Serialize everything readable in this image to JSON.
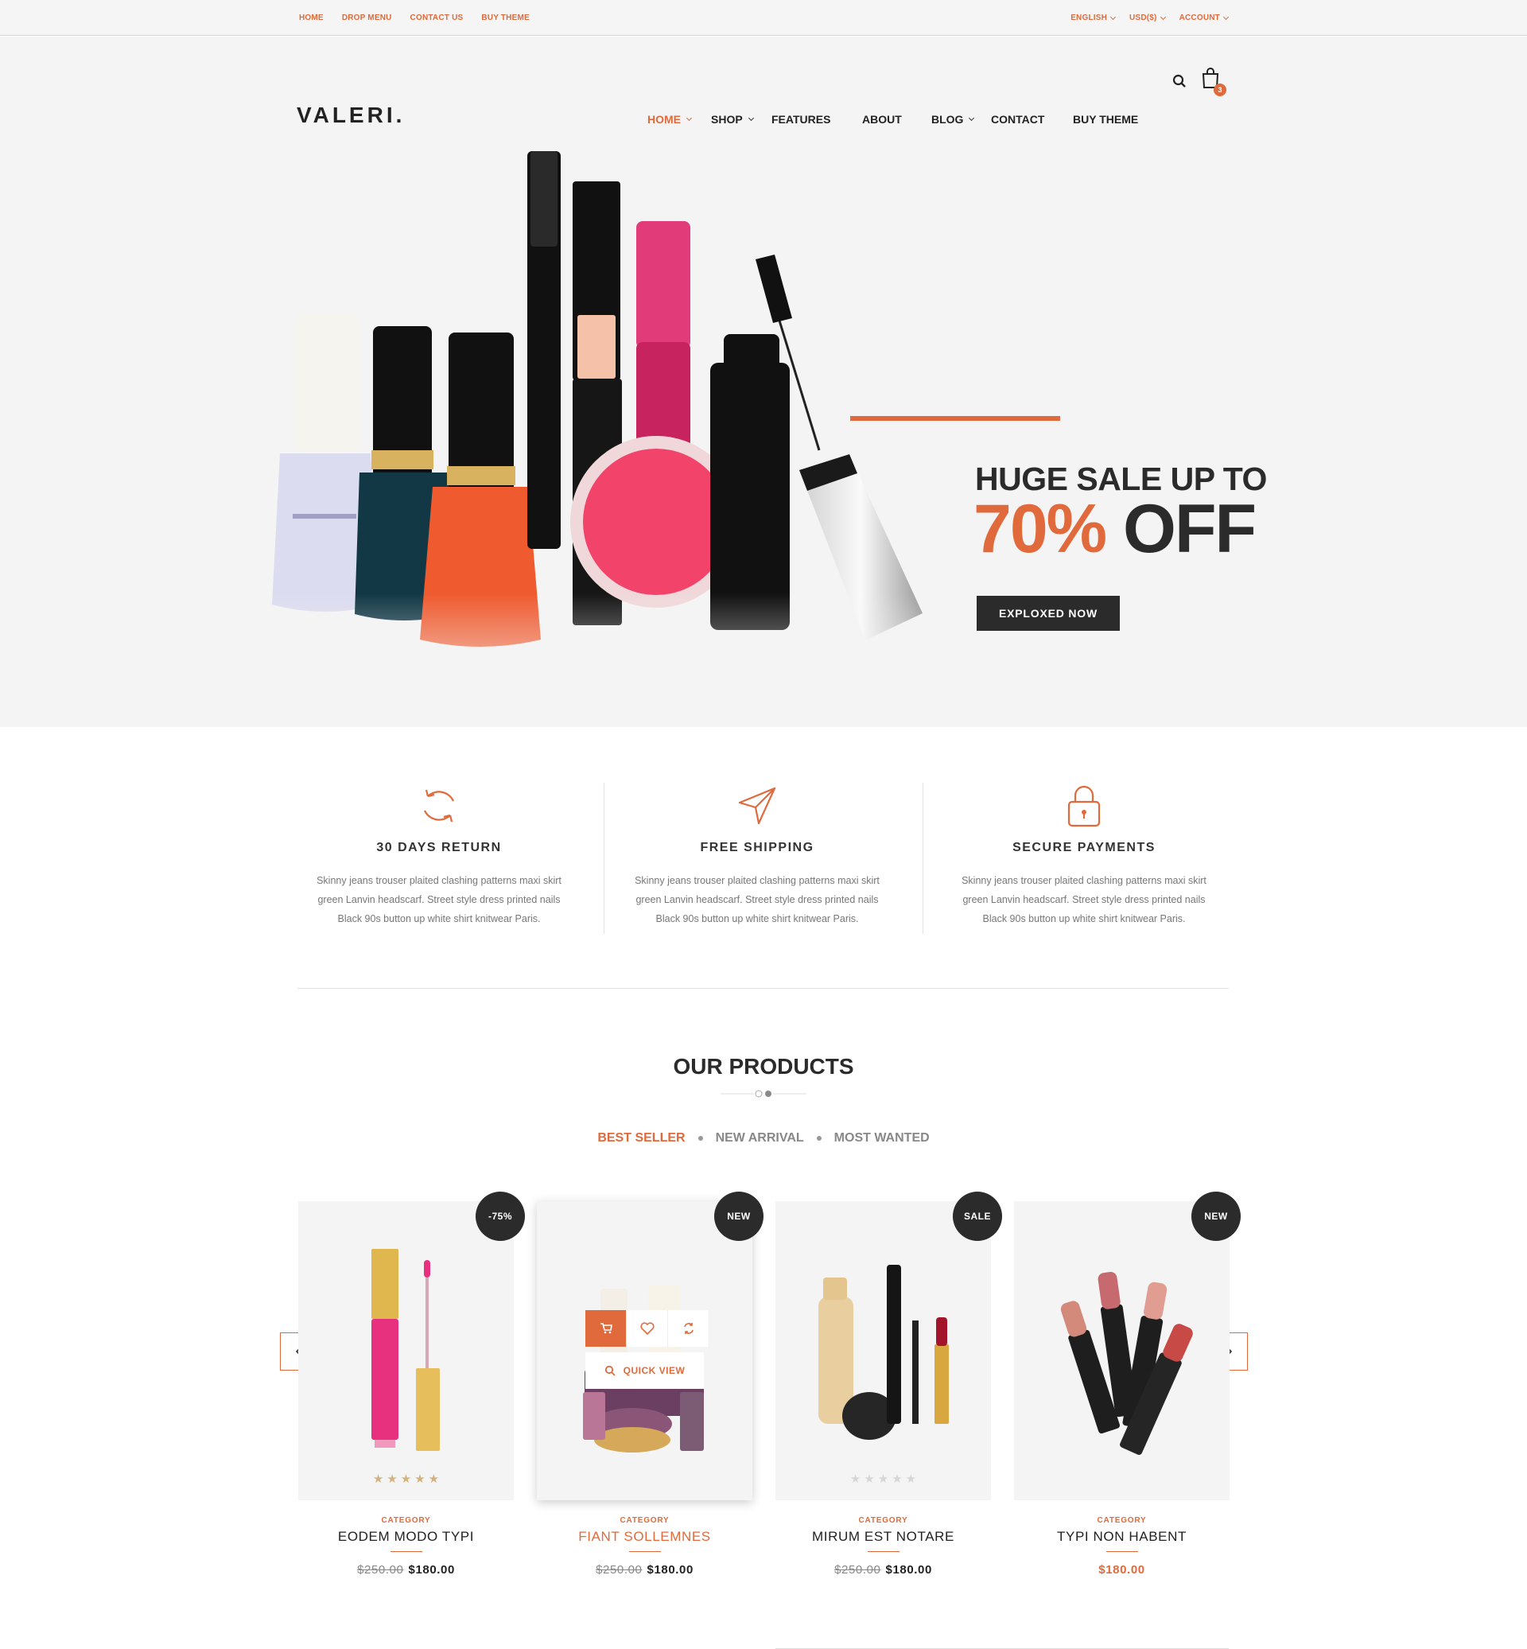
{
  "topbar": {
    "left_links": [
      "HOME",
      "DROP MENU",
      "CONTACT US",
      "BUY THEME"
    ],
    "right_links": [
      "ENGLISH",
      "USD($)",
      "ACCOUNT"
    ]
  },
  "header": {
    "logo": "VALERI.",
    "nav": [
      "HOME",
      "SHOP",
      "FEATURES",
      "ABOUT",
      "BLOG",
      "CONTACT",
      "BUY THEME"
    ],
    "active_nav": "HOME",
    "cart_count": "3"
  },
  "hero": {
    "line1": "HUGE SALE UP TO",
    "percent": "70%",
    "off": "OFF",
    "button": "EXPLOXED NOW"
  },
  "features": [
    {
      "icon": "refresh-icon",
      "title": "30 DAYS RETURN",
      "text": "Skinny jeans trouser plaited clashing patterns maxi skirt green Lanvin headscarf. Street style dress printed nails Black 90s button up white shirt knitwear Paris."
    },
    {
      "icon": "paper-plane-icon",
      "title": "FREE SHIPPING",
      "text": "Skinny jeans trouser plaited clashing patterns maxi skirt green Lanvin headscarf. Street style dress printed nails Black 90s button up white shirt knitwear Paris."
    },
    {
      "icon": "lock-icon",
      "title": "SECURE PAYMENTS",
      "text": "Skinny jeans trouser plaited clashing patterns maxi skirt green Lanvin headscarf. Street style dress printed nails Black 90s button up white shirt knitwear Paris."
    }
  ],
  "products_section": {
    "title": "OUR PRODUCTS",
    "tabs": [
      "BEST SELLER",
      "NEW ARRIVAL",
      "MOST WANTED"
    ],
    "active_tab": "BEST SELLER",
    "quick_view": "QUICK VIEW"
  },
  "products": [
    {
      "badge": "-75%",
      "category": "CATEGORY",
      "name": "EODEM MODO TYPI",
      "old_price": "$250.00",
      "price": "$180.00",
      "rating": 5
    },
    {
      "badge": "NEW",
      "category": "CATEGORY",
      "name": "FIANT SOLLEMNES",
      "old_price": "$250.00",
      "price": "$180.00",
      "rating": 0
    },
    {
      "badge": "SALE",
      "category": "CATEGORY",
      "name": "MIRUM EST NOTARE",
      "old_price": "$250.00",
      "price": "$180.00",
      "rating": 0
    },
    {
      "badge": "NEW",
      "category": "CATEGORY",
      "name": "TYPI NON HABENT",
      "old_price": "",
      "price": "$180.00",
      "rating": 0
    }
  ],
  "colors": {
    "accent": "#e06a3b",
    "dark": "#2b2b2b",
    "hero_bg": "#f4f4f4"
  }
}
